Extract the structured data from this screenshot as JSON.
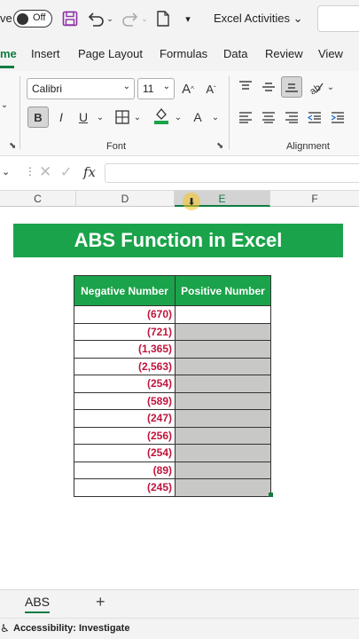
{
  "qat": {
    "autosave_label": "ve",
    "toggle_state": "Off",
    "document_title": "Excel Activities",
    "icons": [
      "save-icon",
      "undo-icon",
      "redo-icon",
      "new-file-icon",
      "customize-icon"
    ]
  },
  "tabs": [
    {
      "label": "me",
      "active": true
    },
    {
      "label": "Insert"
    },
    {
      "label": "Page Layout"
    },
    {
      "label": "Formulas"
    },
    {
      "label": "Data"
    },
    {
      "label": "Review"
    },
    {
      "label": "View"
    }
  ],
  "ribbon": {
    "font_name": "Calibri",
    "font_size": "11",
    "font_group_label": "Font",
    "alignment_group_label": "Alignment",
    "bold": "B",
    "italic": "I",
    "underline": "U",
    "grow_font": "A",
    "shrink_font": "A",
    "font_color": "A"
  },
  "formula_bar": {
    "fx_label": "fx",
    "value": ""
  },
  "columns": [
    {
      "label": "C",
      "selected": false
    },
    {
      "label": "D",
      "selected": false
    },
    {
      "label": "E",
      "selected": true
    },
    {
      "label": "F",
      "selected": false
    }
  ],
  "banner_title": "ABS Function in Excel",
  "table": {
    "headers": [
      "Negative Number",
      "Positive Number"
    ],
    "rows": [
      {
        "negative": "(670)",
        "positive": ""
      },
      {
        "negative": "(721)",
        "positive": ""
      },
      {
        "negative": "(1,365)",
        "positive": ""
      },
      {
        "negative": "(2,563)",
        "positive": ""
      },
      {
        "negative": "(254)",
        "positive": ""
      },
      {
        "negative": "(589)",
        "positive": ""
      },
      {
        "negative": "(247)",
        "positive": ""
      },
      {
        "negative": "(256)",
        "positive": ""
      },
      {
        "negative": "(254)",
        "positive": ""
      },
      {
        "negative": "(89)",
        "positive": ""
      },
      {
        "negative": "(245)",
        "positive": ""
      }
    ]
  },
  "sheet_tab": "ABS",
  "add_sheet_label": "+",
  "status": {
    "accessibility": "Accessibility: Investigate"
  },
  "colors": {
    "accent_green": "#107c41",
    "banner_green": "#1aa34a",
    "negative_red": "#c0143c",
    "selection_gray": "#c8c9c6"
  }
}
